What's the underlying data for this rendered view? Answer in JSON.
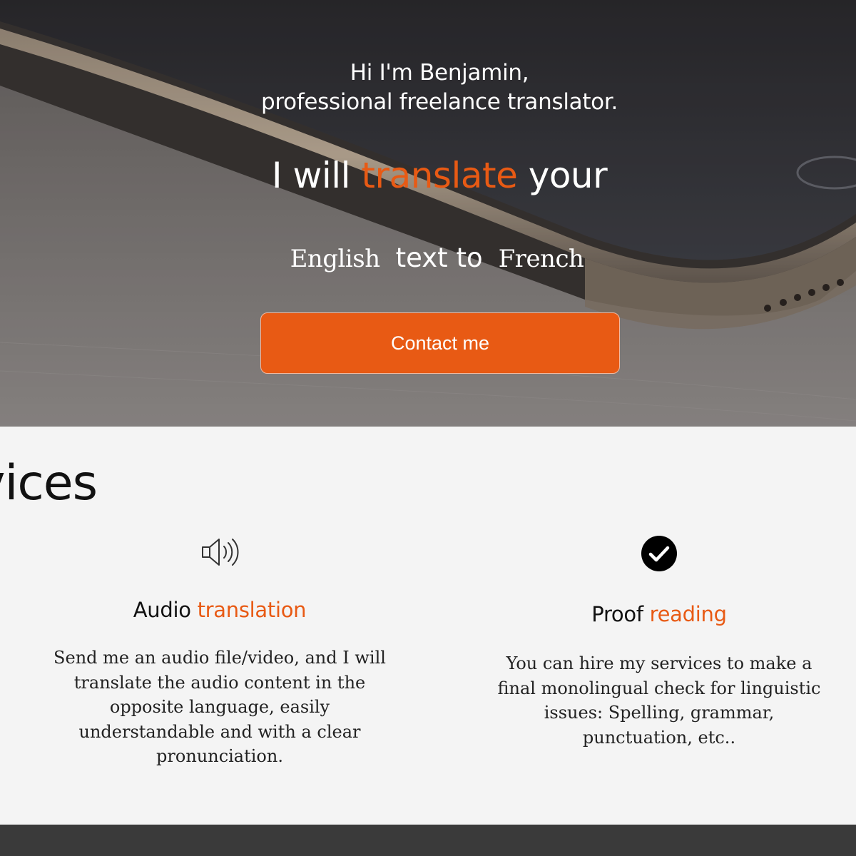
{
  "hero": {
    "intro_line1": "Hi I'm Benjamin,",
    "intro_line2": "professional freelance translator.",
    "tagline_prefix": "I will ",
    "tagline_accent": "translate",
    "tagline_suffix": " your",
    "source_language": "English",
    "connector": "text to",
    "target_language": "French",
    "contact_label": "Contact me"
  },
  "services": {
    "title": "Services",
    "items": [
      {
        "icon": "speaker-icon",
        "title_plain": "Audio ",
        "title_accent": "translation",
        "description": "Send me an audio file/video, and I will translate the audio content in the opposite language, easily understandable and with a clear pronunciation."
      },
      {
        "icon": "checkmark-circle-icon",
        "title_plain": "Proof ",
        "title_accent": "reading",
        "description": "You can hire my services to make a final monolingual check for linguistic issues: Spelling, grammar, punctuation, etc.."
      }
    ]
  },
  "colors": {
    "accent": "#e85a14",
    "text_dark": "#111111",
    "section_bg": "#f4f4f4",
    "footer_bg": "#3a3a3a"
  }
}
